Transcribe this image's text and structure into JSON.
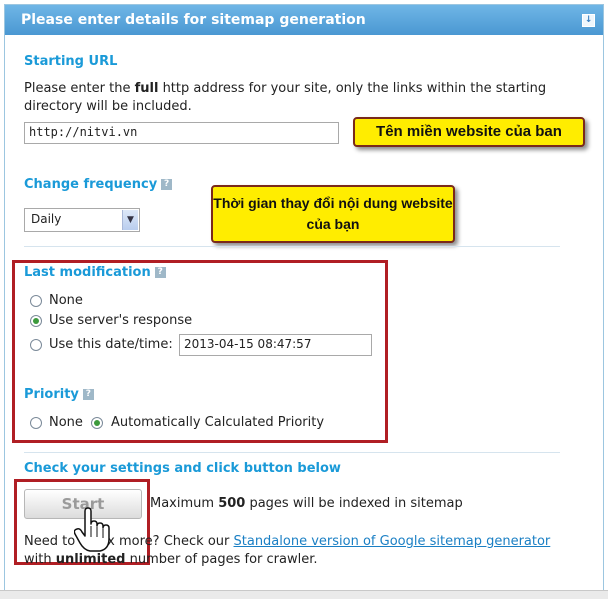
{
  "header": {
    "title": "Please enter details for sitemap generation",
    "collapse_icon": "↓"
  },
  "starting_url": {
    "title": "Starting URL",
    "desc_before": "Please enter the ",
    "desc_bold": "full",
    "desc_after": " http address for your site, only the links within the starting directory will be included.",
    "value": "http://nitvi.vn",
    "callout": "Tên miền website của ban"
  },
  "change_frequency": {
    "title": "Change frequency",
    "help": "?",
    "selected": "Daily",
    "callout": "Thời gian thay đổi nội dung website của bạn"
  },
  "last_modification": {
    "title": "Last modification",
    "help": "?",
    "options": [
      "None",
      "Use server's response",
      "Use this date/time:"
    ],
    "selected_index": 1,
    "date_value": "2013-04-15 08:47:57"
  },
  "priority": {
    "title": "Priority",
    "help": "?",
    "options": [
      "None",
      "Automatically Calculated Priority"
    ],
    "selected_index": 1
  },
  "check": {
    "title": "Check your settings and click button below",
    "start_label": "Start",
    "max_before": "Maximum ",
    "max_count": "500",
    "max_after": " pages will be indexed in sitemap",
    "need_before": "Need to index more? Check our ",
    "link_text": "Standalone version of Google sitemap generator",
    "need_line2_before": "with ",
    "need_bold": "unlimited",
    "need_line2_after": " number of pages for crawler."
  },
  "colors": {
    "accent": "#1a9ad8",
    "header": "#4a98d2",
    "callout": "#ffed00",
    "highlight": "#b01e24"
  }
}
